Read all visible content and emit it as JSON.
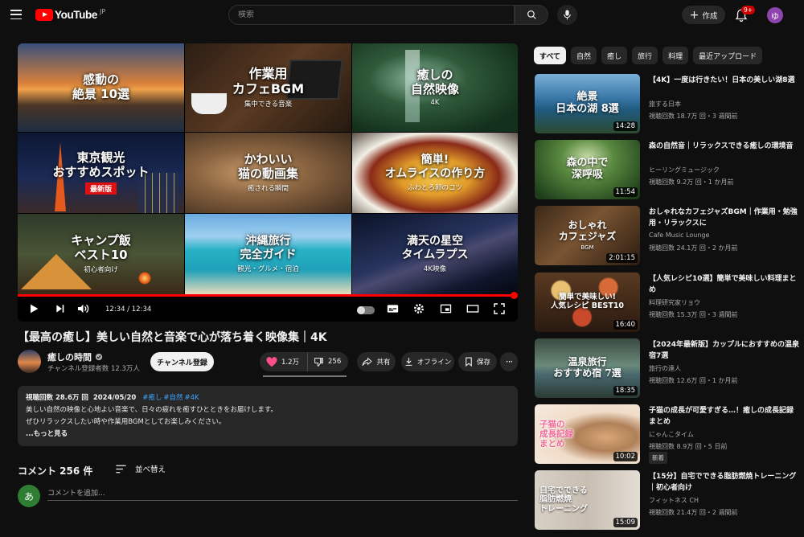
{
  "header": {
    "logo_text": "YouTube",
    "region": "JP",
    "search_placeholder": "検索",
    "create_label": "作成",
    "notification_count": "9+",
    "user_initial": "ゆ"
  },
  "player": {
    "thumbnails": [
      {
        "title": "感動の\n絶景 10選",
        "subtitle": ""
      },
      {
        "title": "作業用\nカフェBGM",
        "subtitle": "集中できる音楽"
      },
      {
        "title": "癒しの\n自然映像",
        "subtitle": "4K"
      },
      {
        "title": "東京観光\nおすすめスポット",
        "subtitle": "",
        "badge": "最新版"
      },
      {
        "title": "かわいい\n猫の動画集",
        "subtitle": "癒される瞬間"
      },
      {
        "title": "簡単!\nオムライスの作り方",
        "subtitle": "ふわとろ卵のコツ"
      },
      {
        "title": "キャンプ飯\nベスト10",
        "subtitle": "初心者向け"
      },
      {
        "title": "沖縄旅行\n完全ガイド",
        "subtitle": "観光・グルメ・宿泊"
      },
      {
        "title": "満天の星空\nタイムラプス",
        "subtitle": "4K映像"
      }
    ],
    "time_display": "12:34 / 12:34",
    "progress": 1.0
  },
  "video": {
    "title": "【最高の癒し】美しい自然と音楽で心が落ち着く映像集｜4K",
    "channel_name": "癒しの時間",
    "subscribers": "チャンネル登録者数 12.3万人",
    "subscribe_label": "チャンネル登録",
    "likes": "1.2万",
    "dislikes": "256",
    "share_label": "共有",
    "offline_label": "オフライン",
    "save_label": "保存"
  },
  "description": {
    "views": "視聴回数 28.6万 回",
    "date": "2024/05/20",
    "tags": [
      "#癒し",
      "#自然",
      "#4K"
    ],
    "line1": "美しい自然の映像と心地よい音楽で、日々の疲れを癒すひとときをお届けします。",
    "line2": "ぜひリラックスしたい時や作業用BGMとしてお楽しみください。",
    "more": "...もっと見る"
  },
  "comments": {
    "count_label": "コメント 256 件",
    "sort_label": "並べ替え",
    "avatar_initial": "あ",
    "placeholder": "コメントを追加..."
  },
  "chips": [
    "すべて",
    "自然",
    "癒し",
    "旅行",
    "料理",
    "最近アップロード"
  ],
  "recommendations": [
    {
      "thumb_title": "絶景\n日本の湖 8選",
      "thumb_sub": "",
      "duration": "14:28",
      "title": "【4K】一度は行きたい！日本の美しい湖8選",
      "channel": "旅する日本",
      "stats": "視聴回数 18.7万 回・3 週間前",
      "badge": ""
    },
    {
      "thumb_title": "森の中で\n深呼吸",
      "thumb_sub": "",
      "duration": "11:54",
      "title": "森の自然音｜リラックスできる癒しの環境音",
      "channel": "ヒーリングミュージック",
      "stats": "視聴回数 9.2万 回・1 か月前",
      "badge": ""
    },
    {
      "thumb_title": "おしゃれ\nカフェジャズ",
      "thumb_sub": "BGM",
      "duration": "2:01:15",
      "title": "おしゃれなカフェジャズBGM｜作業用・勉強用・リラックスに",
      "channel": "Cafe Music Lounge",
      "stats": "視聴回数 24.1万 回・2 か月前",
      "badge": ""
    },
    {
      "thumb_title": "簡単で美味しい!\n人気レシピ BEST10",
      "thumb_sub": "",
      "duration": "16:40",
      "title": "【人気レシピ10選】簡単で美味しい料理まとめ",
      "channel": "料理研究家リョウ",
      "stats": "視聴回数 15.3万 回・3 週間前",
      "badge": ""
    },
    {
      "thumb_title": "温泉旅行\nおすすめ宿 7選",
      "thumb_sub": "",
      "duration": "18:35",
      "title": "【2024年最新版】カップルにおすすめの温泉宿7選",
      "channel": "旅行の達人",
      "stats": "視聴回数 12.6万 回・1 か月前",
      "badge": ""
    },
    {
      "thumb_title": "子猫の\n成長記録\nまとめ",
      "thumb_sub": "",
      "duration": "10:02",
      "title": "子猫の成長が可愛すぎる…！癒しの成長記録まとめ",
      "channel": "にゃんこタイム",
      "stats": "視聴回数 8.9万 回・5 日前",
      "badge": "新着"
    },
    {
      "thumb_title": "自宅でできる\n脂肪燃焼\nトレーニング",
      "thumb_sub": "",
      "duration": "15:09",
      "title": "【15分】自宅でできる脂肪燃焼トレーニング｜初心者向け",
      "channel": "フィットネス CH",
      "stats": "視聴回数 21.4万 回・2 週間前",
      "badge": ""
    }
  ]
}
